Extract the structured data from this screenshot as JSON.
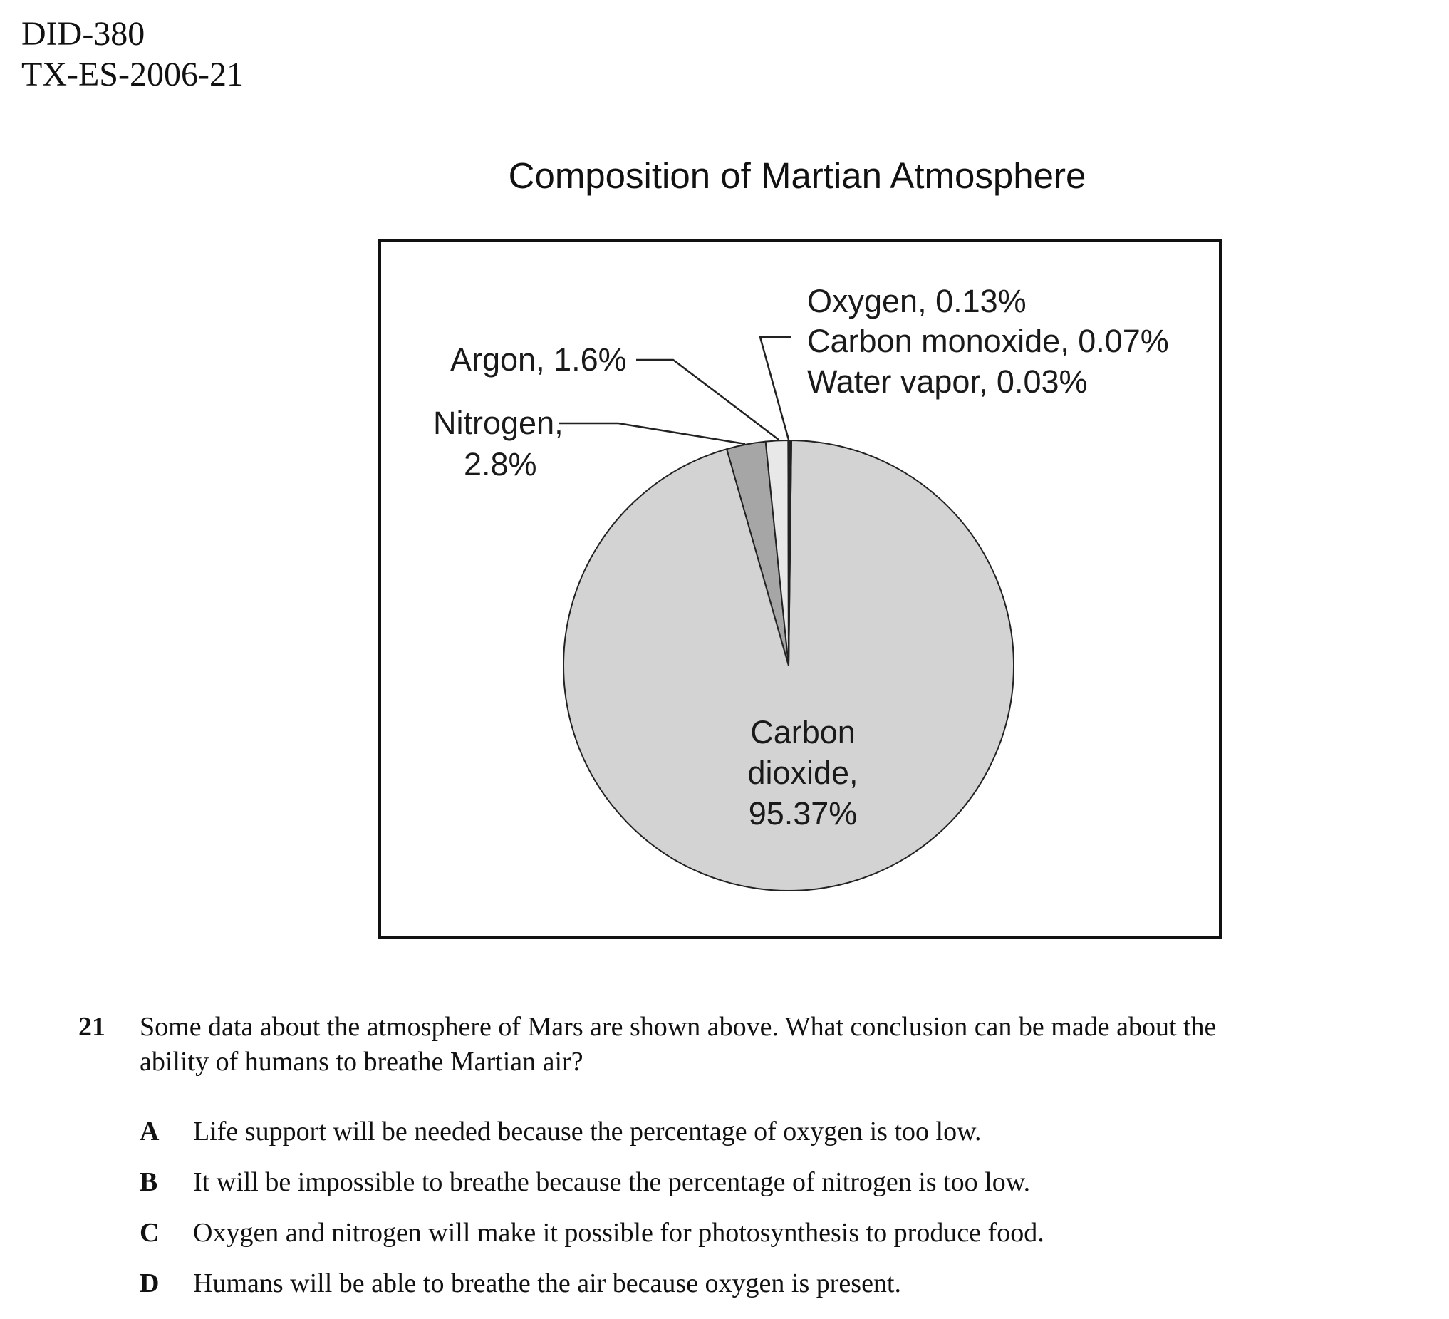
{
  "header": {
    "id_line_1": "DID-380",
    "id_line_2": "TX-ES-2006-21"
  },
  "chart_data": {
    "type": "pie",
    "title": "Composition of Martian Atmosphere",
    "slices": [
      {
        "label": "Carbon dioxide",
        "value": 95.37,
        "color": "#d3d3d3"
      },
      {
        "label": "Nitrogen",
        "value": 2.8,
        "color": "#a6a6a6"
      },
      {
        "label": "Argon",
        "value": 1.6,
        "color": "#e8e8e8"
      },
      {
        "label": "Oxygen",
        "value": 0.13,
        "color": "#555555"
      },
      {
        "label": "Carbon monoxide",
        "value": 0.07,
        "color": "#555555"
      },
      {
        "label": "Water vapor",
        "value": 0.03,
        "color": "#555555"
      }
    ],
    "labels": {
      "argon": "Argon, 1.6%",
      "nitrogen_line_1": "Nitrogen,",
      "nitrogen_line_2": "2.8%",
      "oxygen": "Oxygen, 0.13%",
      "carbon_monoxide": "Carbon monoxide, 0.07%",
      "water_vapor": "Water vapor, 0.03%",
      "co2_line_1": "Carbon",
      "co2_line_2": "dioxide,",
      "co2_line_3": "95.37%"
    }
  },
  "question": {
    "number": "21",
    "text_line_1": "Some data about the atmosphere of Mars are shown above. What conclusion can be made about the",
    "text_line_2": "ability of humans to breathe Martian air?",
    "choices": [
      {
        "letter": "A",
        "text": "Life support will be needed because the percentage of oxygen is too low."
      },
      {
        "letter": "B",
        "text": "It will be impossible to breathe because the percentage of nitrogen is too low."
      },
      {
        "letter": "C",
        "text": "Oxygen and nitrogen will make it possible for photosynthesis to produce food."
      },
      {
        "letter": "D",
        "text": "Humans will be able to breathe the air because oxygen is present."
      }
    ]
  }
}
